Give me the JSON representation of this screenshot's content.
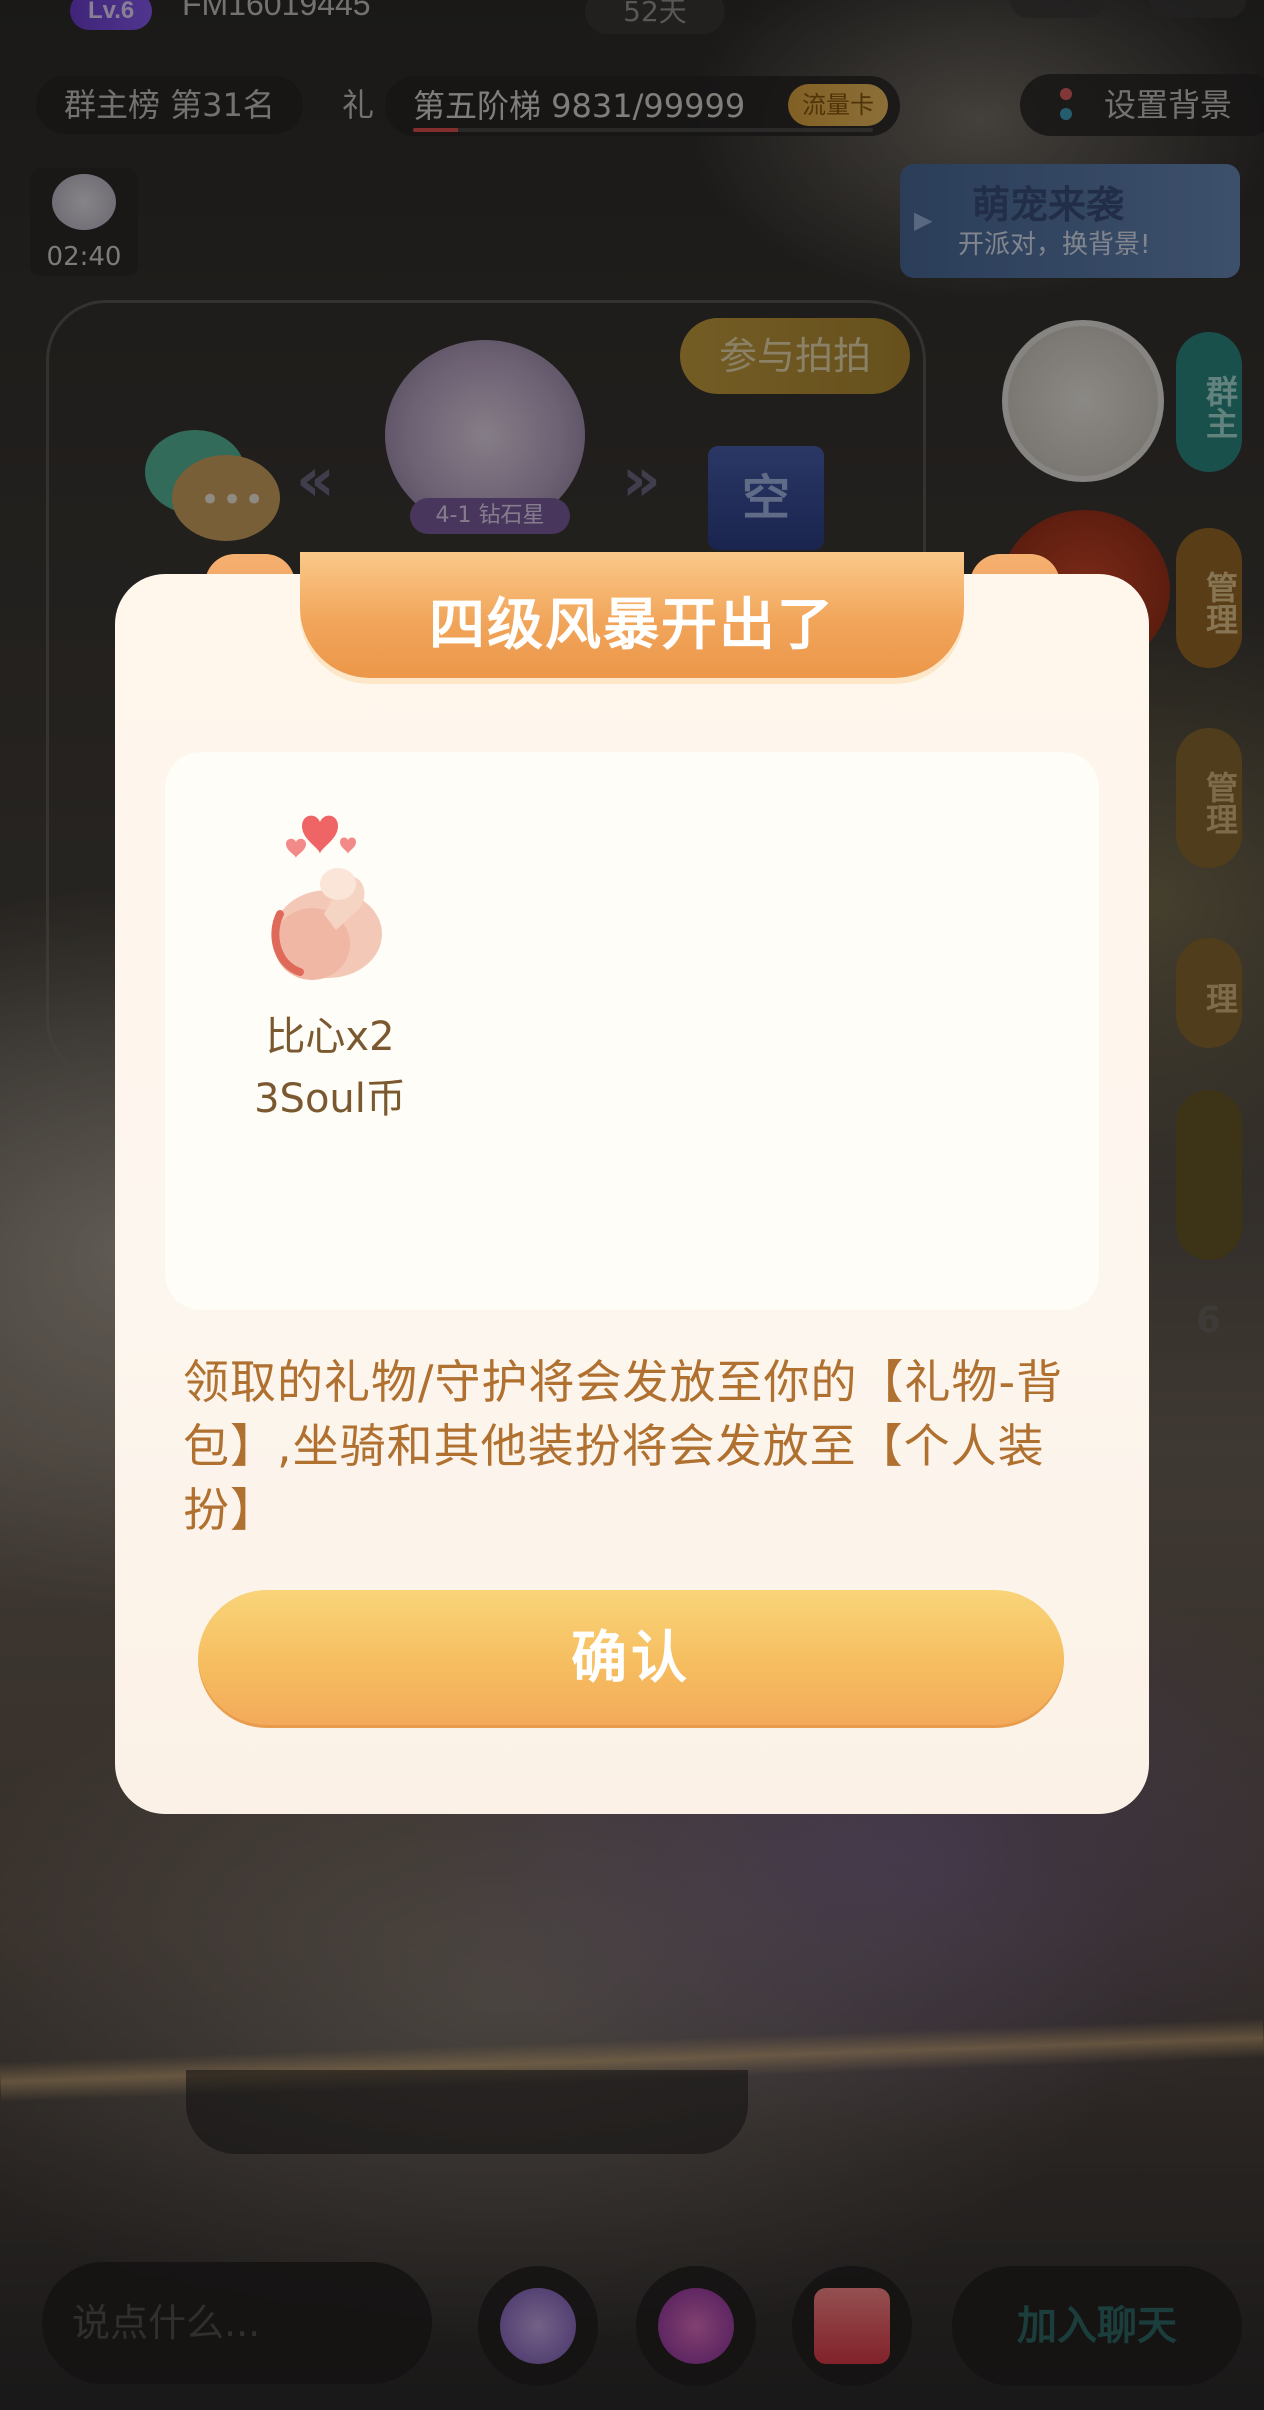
{
  "header": {
    "level_badge": "Lv.6",
    "room_id": "FM16019445",
    "days": "52天"
  },
  "ranks": {
    "group_rank": "群主榜 第31名",
    "truncated_chip": "礼",
    "ladder_text": "第五阶梯 9831/99999",
    "ladder_progress": 0.098,
    "flow_card": "流量卡",
    "set_background": "设置背景"
  },
  "room": {
    "timer": "02:40",
    "pet_banner_title": "萌宠来袭",
    "pet_banner_sub": "开派对，换背景!",
    "join_photo": "参与拍拍",
    "avatar_label": "4-1 钻石星",
    "empty_seat": "空",
    "side_tabs": [
      "群主",
      "管理",
      "管理",
      "理"
    ],
    "side_count": "6"
  },
  "bottom": {
    "chat_placeholder": "说点什么...",
    "join_chat": "加入聊天"
  },
  "modal": {
    "title": "四级风暴开出了",
    "reward": {
      "name": "比心x2",
      "coin": "3Soul币",
      "icon": "finger-heart-icon"
    },
    "notice": "领取的礼物/守护将会发放至你的【礼物-背包】,坐骑和其他装扮将会发放至【个人装扮】",
    "confirm": "确认"
  },
  "colors": {
    "modal_bg": "#fdf6ee",
    "header_orange": "#f1a55a",
    "confirm_yellow": "#f6bd5f",
    "notice_text": "#b07030",
    "join_chat_text": "#2f6a66"
  }
}
